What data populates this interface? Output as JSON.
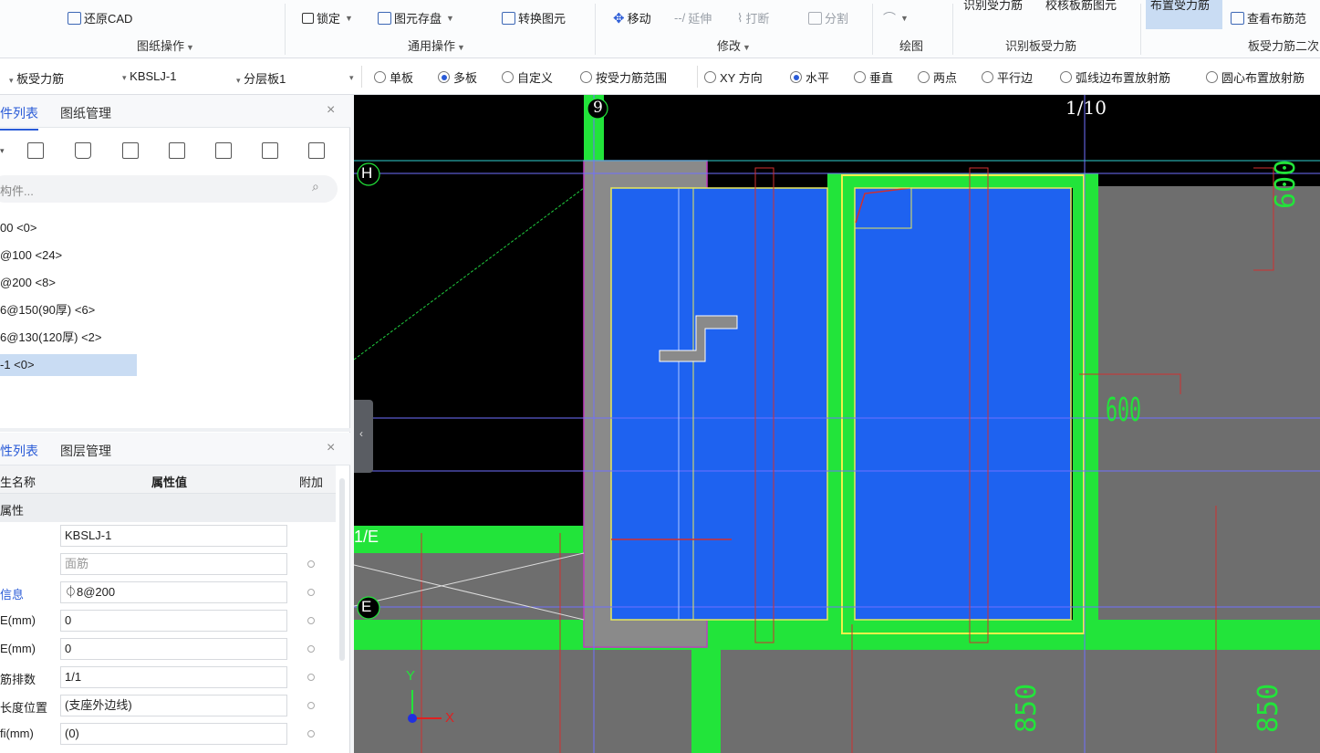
{
  "ribbon": {
    "restore_cad": "还原CAD",
    "lock": "锁定",
    "save_elements": "图元存盘",
    "convert_elements": "转换图元",
    "move": "移动",
    "extend": "延伸",
    "break": "打断",
    "split": "分割",
    "identify_rebar": "识别受力筋",
    "check_rebar": "校核板筋图元",
    "place_rebar": "布置受力筋",
    "view_range": "查看布筋范",
    "groups": {
      "drawing_ops": "图纸操作",
      "general_ops": "通用操作",
      "modify": "修改",
      "draw": "绘图",
      "identify_slab_rebar": "识别板受力筋",
      "slab_rebar_2": "板受力筋二次"
    }
  },
  "optbar": {
    "combo1": "板受力筋",
    "combo2": "KBSLJ-1",
    "combo3": "分层板1",
    "radios": [
      {
        "label": "单板",
        "checked": false
      },
      {
        "label": "多板",
        "checked": true
      },
      {
        "label": "自定义",
        "checked": false
      },
      {
        "label": "按受力筋范围",
        "checked": false
      },
      {
        "label": "XY 方向",
        "checked": false
      },
      {
        "label": "水平",
        "checked": true
      },
      {
        "label": "垂直",
        "checked": false
      },
      {
        "label": "两点",
        "checked": false
      },
      {
        "label": "平行边",
        "checked": false
      },
      {
        "label": "弧线边布置放射筋",
        "checked": false
      },
      {
        "label": "圆心布置放射筋",
        "checked": false
      }
    ]
  },
  "component_panel": {
    "tab_active": "件列表",
    "tab_other": "图纸管理",
    "search_placeholder": "构件...",
    "items": [
      "00 <0>",
      "@100 <24>",
      "@200 <8>",
      "6@150(90厚)   <6>",
      "6@130(120厚)   <2>",
      "-1 <0>"
    ]
  },
  "property_panel": {
    "tab_active": "性列表",
    "tab_other": "图层管理",
    "col_name": "生名称",
    "col_value": "属性值",
    "col_extra": "附加",
    "section": "属性",
    "rows": [
      {
        "name": "",
        "value": "KBSLJ-1",
        "dot": false
      },
      {
        "name": "",
        "value": "面筋",
        "dot": true
      },
      {
        "name": "信息",
        "value": "⏀8@200",
        "dot": true
      },
      {
        "name": "E(mm)",
        "value": "0",
        "dot": true
      },
      {
        "name": "E(mm)",
        "value": "0",
        "dot": true
      },
      {
        "name": "筋排数",
        "value": "1/1",
        "dot": true
      },
      {
        "name": "长度位置",
        "value": "(支座外边线)",
        "dot": true
      },
      {
        "name": "fi(mm)",
        "value": "(0)",
        "dot": true
      }
    ]
  },
  "canvas": {
    "axis_labels": [
      "9",
      "1/10",
      "H",
      "1/E",
      "E"
    ],
    "dims": [
      "600",
      "600",
      "850",
      "850"
    ],
    "ucs": {
      "y": "Y",
      "x": "X"
    }
  }
}
